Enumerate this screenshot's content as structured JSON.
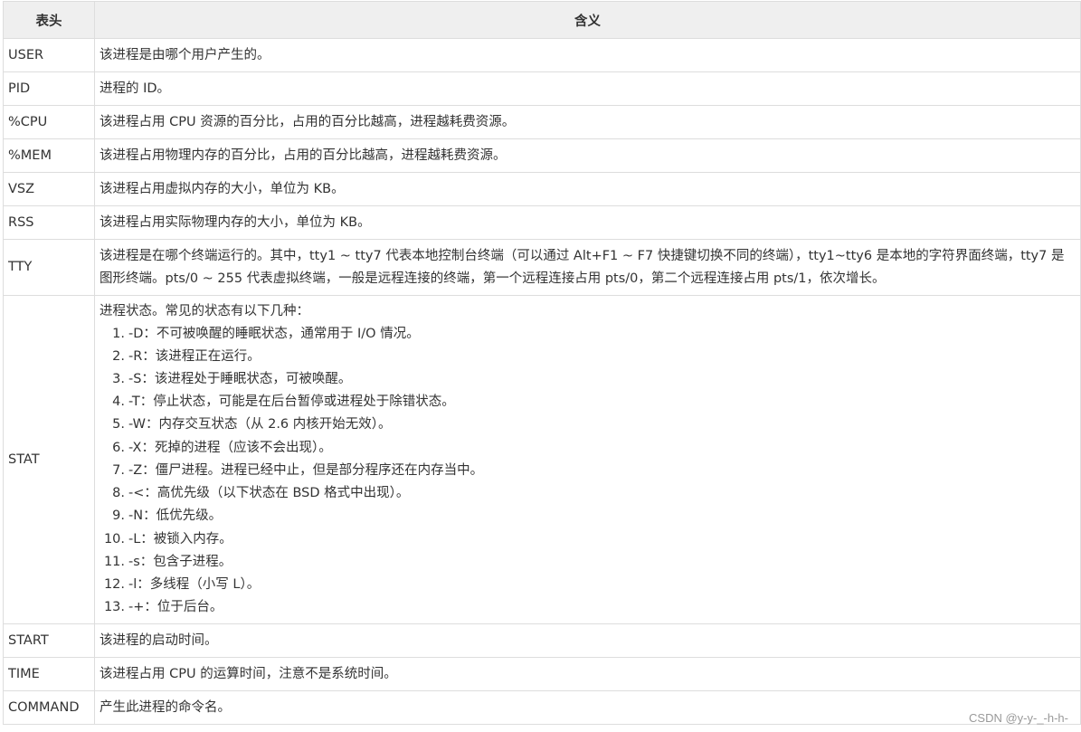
{
  "header": {
    "col_key": "表头",
    "col_meaning": "含义"
  },
  "rows": [
    {
      "key": "USER",
      "text": "该进程是由哪个用户产生的。"
    },
    {
      "key": "PID",
      "text": "进程的 ID。"
    },
    {
      "key": "%CPU",
      "text": "该进程占用 CPU 资源的百分比，占用的百分比越高，进程越耗费资源。"
    },
    {
      "key": "%MEM",
      "text": "该进程占用物理内存的百分比，占用的百分比越高，进程越耗费资源。"
    },
    {
      "key": "VSZ",
      "text": "该进程占用虚拟内存的大小，单位为 KB。"
    },
    {
      "key": "RSS",
      "text": "该进程占用实际物理内存的大小，单位为 KB。"
    },
    {
      "key": "TTY",
      "text": "该进程是在哪个终端运行的。其中，tty1 ~ tty7 代表本地控制台终端（可以通过 Alt+F1 ~ F7 快捷键切换不同的终端），tty1~tty6 是本地的字符界面终端，tty7 是图形终端。pts/0 ~ 255 代表虚拟终端，一般是远程连接的终端，第一个远程连接占用 pts/0，第二个远程连接占用 pts/1，依次增长。"
    },
    {
      "key": "STAT",
      "intro": "进程状态。常见的状态有以下几种：",
      "states": [
        {
          "num": "1.",
          "text": "-D：不可被唤醒的睡眠状态，通常用于 I/O 情况。"
        },
        {
          "num": "2.",
          "text": "-R：该进程正在运行。"
        },
        {
          "num": "3.",
          "text": "-S：该进程处于睡眠状态，可被唤醒。"
        },
        {
          "num": "4.",
          "text": "-T：停止状态，可能是在后台暂停或进程处于除错状态。"
        },
        {
          "num": "5.",
          "text": "-W：内存交互状态（从 2.6 内核开始无效）。"
        },
        {
          "num": "6.",
          "text": "-X：死掉的进程（应该不会出现）。"
        },
        {
          "num": "7.",
          "text": "-Z：僵尸进程。进程已经中止，但是部分程序还在内存当中。"
        },
        {
          "num": "8.",
          "text": "-<：高优先级（以下状态在 BSD 格式中出现）。"
        },
        {
          "num": "9.",
          "text": "-N：低优先级。"
        },
        {
          "num": "10.",
          "text": "-L：被锁入内存。"
        },
        {
          "num": "11.",
          "text": "-s：包含子进程。"
        },
        {
          "num": "12.",
          "text": "-l：多线程（小写 L）。"
        },
        {
          "num": "13.",
          "text": "-+：位于后台。"
        }
      ]
    },
    {
      "key": "START",
      "text": "该进程的启动时间。"
    },
    {
      "key": "TIME",
      "text": "该进程占用 CPU 的运算时间，注意不是系统时间。"
    },
    {
      "key": "COMMAND",
      "text": "产生此进程的命令名。"
    }
  ],
  "watermark": "CSDN @y-y-_-h-h-"
}
